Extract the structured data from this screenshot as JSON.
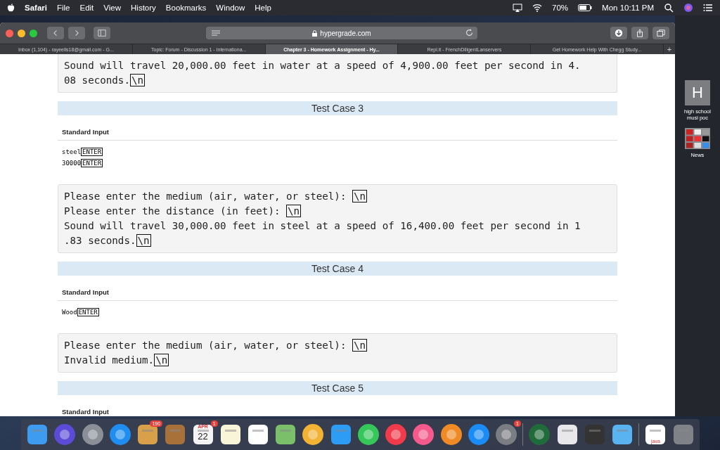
{
  "menubar": {
    "app": "Safari",
    "menus": [
      "File",
      "Edit",
      "View",
      "History",
      "Bookmarks",
      "Window",
      "Help"
    ],
    "battery": "70%",
    "clock": "Mon 10:11 PM"
  },
  "browser": {
    "address": "hypergrade.com",
    "tabs": [
      {
        "label": "Inbox (1,104) - rayeells18@gmail.com - G...",
        "selected": false
      },
      {
        "label": "Topic: Forum - Discussion 1 - Internationa...",
        "selected": false
      },
      {
        "label": "Chapter 3 - Homework Assignment - Hy...",
        "selected": true
      },
      {
        "label": "Repl.it - FrenchDiligentLanservers",
        "selected": false
      },
      {
        "label": "Get Homework Help With Chegg Study...",
        "selected": false
      }
    ],
    "new_tab": "+"
  },
  "page": [
    {
      "kind": "output",
      "lines": [
        {
          "text": "Sound will travel 20,000.00 feet in water at a speed of 4,900.00 feet per second in 4."
        },
        {
          "text": "08 seconds.",
          "key": "\\n"
        }
      ]
    },
    {
      "kind": "header",
      "text": "Test Case 3"
    },
    {
      "kind": "input",
      "label": "Standard Input",
      "lines": [
        {
          "text": "steel",
          "key": "ENTER"
        },
        {
          "text": "30000",
          "key": "ENTER"
        }
      ]
    },
    {
      "kind": "output",
      "lines": [
        {
          "text": "Please enter the medium (air, water, or steel): ",
          "key": "\\n"
        },
        {
          "text": "Please enter the distance (in feet): ",
          "key": "\\n"
        },
        {
          "text": "Sound will travel 30,000.00 feet in steel at a speed of 16,400.00 feet per second in 1"
        },
        {
          "text": ".83 seconds.",
          "key": "\\n"
        }
      ]
    },
    {
      "kind": "header",
      "text": "Test Case 4"
    },
    {
      "kind": "input",
      "label": "Standard Input",
      "lines": [
        {
          "text": "Wood",
          "key": "ENTER"
        }
      ]
    },
    {
      "kind": "output",
      "lines": [
        {
          "text": "Please enter the medium (air, water, or steel): ",
          "key": "\\n"
        },
        {
          "text": "Invalid medium.",
          "key": "\\n"
        }
      ]
    },
    {
      "kind": "header",
      "text": "Test Case 5"
    },
    {
      "kind": "input",
      "label": "Standard Input"
    }
  ],
  "desktop": [
    {
      "kind": "letter",
      "glyph": "H",
      "label": "high school musi poc"
    },
    {
      "kind": "news",
      "label": "News"
    }
  ],
  "dock": {
    "mail_badge": "190",
    "calendar_month": "APR",
    "calendar_date": "22",
    "calendar_badge": "1",
    "prefs_badge": "1",
    "file_label": "java"
  }
}
